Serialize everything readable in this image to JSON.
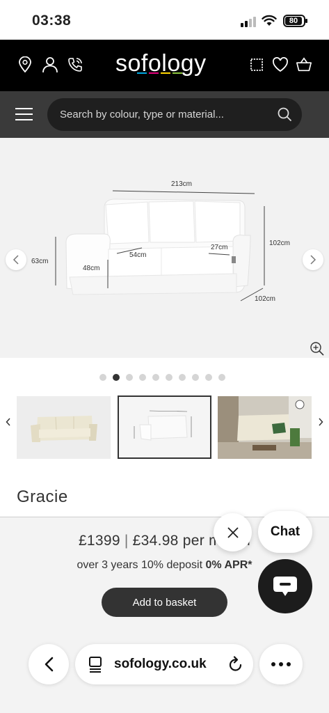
{
  "status_bar": {
    "time": "03:38",
    "battery": "80"
  },
  "header": {
    "logo": "sofology",
    "logo_bar_colors": [
      "#00a7e1",
      "#e6007e",
      "#ffd500",
      "#8dc63f"
    ],
    "left_icons": [
      "location-pin-icon",
      "account-icon",
      "phone-icon"
    ],
    "right_icons": [
      "swatch-icon",
      "heart-icon",
      "basket-icon"
    ]
  },
  "search": {
    "placeholder": "Search by colour, type or material..."
  },
  "product_image": {
    "dimensions": {
      "width": "213cm",
      "height": "102cm",
      "depth": "102cm",
      "arm_height": "63cm",
      "seat_height": "48cm",
      "seat_depth": "54cm",
      "arm_width": "27cm"
    },
    "active_dot_index": 1,
    "dot_count": 10
  },
  "product": {
    "name": "Gracie",
    "price": "£1399",
    "monthly": "£34.98 per month",
    "finance_prefix": "over 3 years 10% deposit",
    "finance_apr": "0% APR*",
    "add_to_basket": "Add to basket"
  },
  "chat": {
    "label": "Chat"
  },
  "browser": {
    "url": "sofology.co.uk"
  }
}
